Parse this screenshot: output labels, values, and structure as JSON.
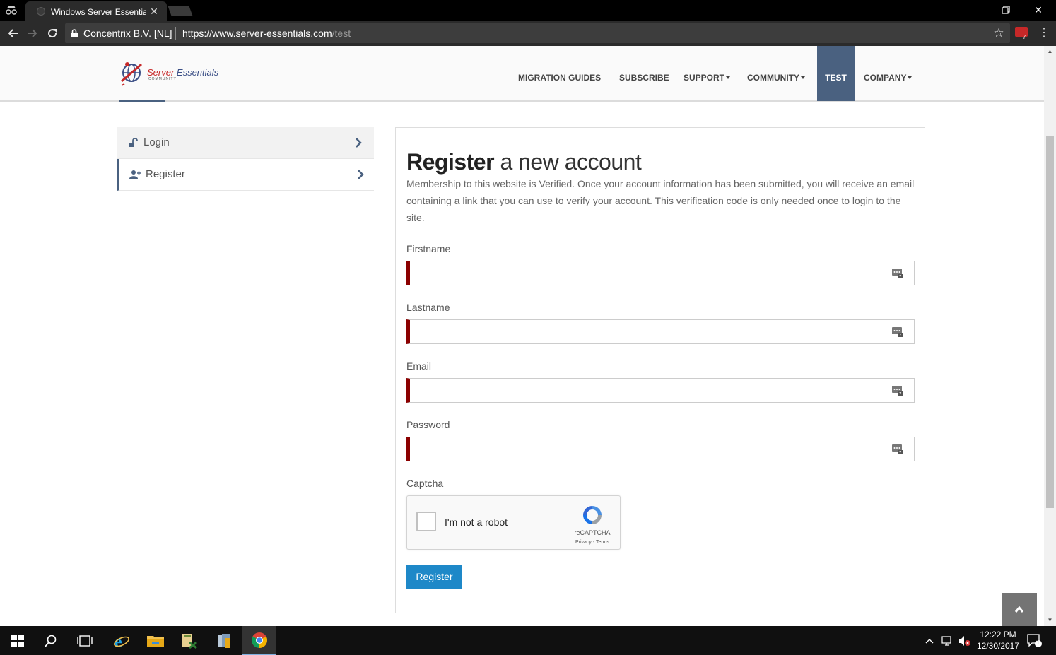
{
  "browser": {
    "tab_title": "Windows Server Essentia",
    "site_identity": "Concentrix B.V. [NL]",
    "url_main": "https://www.server-essentials.com",
    "url_path": "/test",
    "extension_badge": "7"
  },
  "site": {
    "logo_red": "Server",
    "logo_blue": " Essentials",
    "logo_sub": "COMMUNITY",
    "nav": [
      {
        "label": "MIGRATION GUIDES",
        "dropdown": false
      },
      {
        "label": "SUBSCRIBE",
        "dropdown": false
      },
      {
        "label": "SUPPORT",
        "dropdown": true
      },
      {
        "label": "COMMUNITY",
        "dropdown": true
      },
      {
        "label": "TEST",
        "dropdown": false,
        "active": true
      },
      {
        "label": "COMPANY",
        "dropdown": true
      }
    ],
    "accent_color": "#4a6180"
  },
  "sidemenu": {
    "items": [
      {
        "label": "Login",
        "icon": "unlock-icon"
      },
      {
        "label": "Register",
        "icon": "user-plus-icon"
      }
    ]
  },
  "form": {
    "title_bold": "Register",
    "title_light": " a new account",
    "description": "Membership to this website is Verified. Once your account information has been submitted, you will receive an email containing a link that you can use to verify your account. This verification code is only needed once to login to the site.",
    "fields": [
      {
        "label": "Firstname",
        "value": ""
      },
      {
        "label": "Lastname",
        "value": ""
      },
      {
        "label": "Email",
        "value": ""
      },
      {
        "label": "Password",
        "value": ""
      }
    ],
    "captcha_label": "Captcha",
    "captcha_text": "I'm not a robot",
    "captcha_brand": "reCAPTCHA",
    "captcha_links": "Privacy - Terms",
    "submit_label": "Register",
    "required_color": "#8b0000",
    "button_color": "#1e88c8"
  },
  "taskbar": {
    "time": "12:22 PM",
    "date": "12/30/2017",
    "notification_count": "1"
  }
}
